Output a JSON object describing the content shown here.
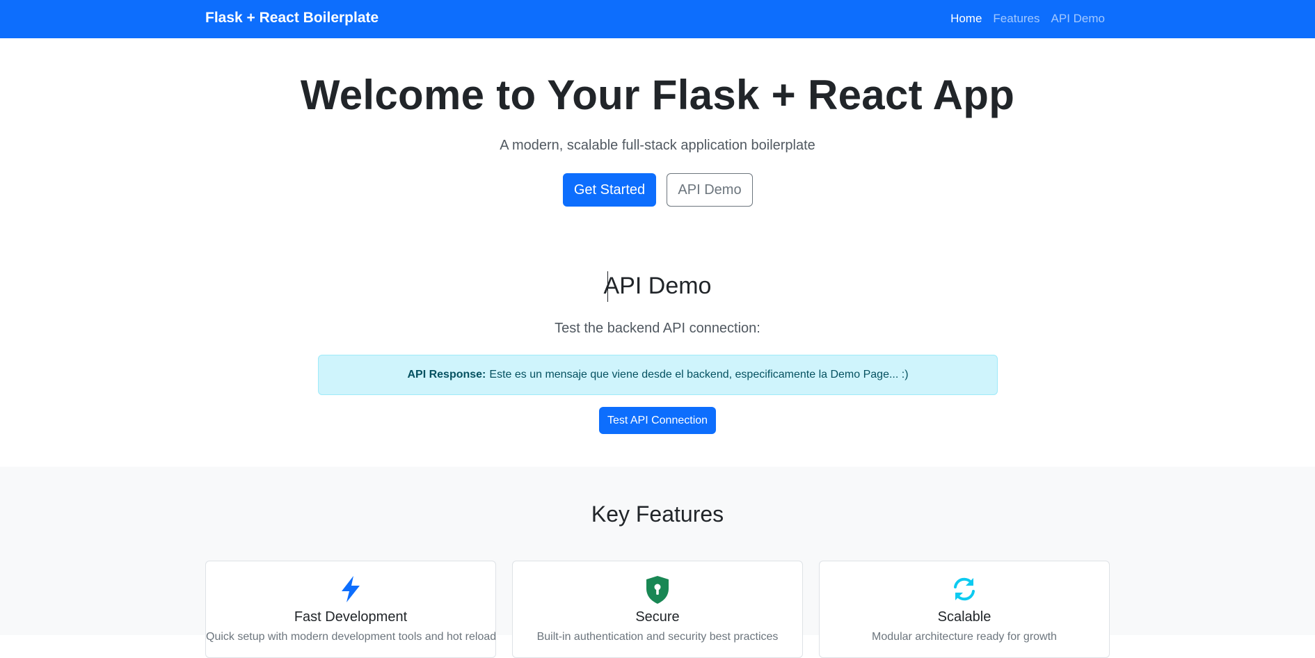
{
  "navbar": {
    "brand": "Flask + React Boilerplate",
    "links": [
      "Home",
      "Features",
      "API Demo"
    ],
    "active_link": "Home",
    "color": "#0d6efd"
  },
  "hero": {
    "title": "Welcome to Your Flask + React App",
    "subtitle": "A modern, scalable full-stack application boilerplate",
    "primary_button": "Get Started",
    "secondary_button": "API Demo"
  },
  "api_demo": {
    "title": "API Demo",
    "subtitle": "Test the backend API connection:",
    "response_label": "API Response:",
    "response_text": "Este es un mensaje que viene desde el backend, especificamente la Demo Page... :)",
    "button": "Test API Connection"
  },
  "features": {
    "title": "Key Features",
    "cards": [
      {
        "icon": "lightning-icon",
        "title": "Fast Development",
        "text": "Quick setup with modern development tools and hot reload"
      },
      {
        "icon": "shield-lock-icon",
        "title": "Secure",
        "text": "Built-in authentication and security best practices"
      },
      {
        "icon": "refresh-icon",
        "title": "Scalable",
        "text": "Modular architecture ready for growth"
      }
    ]
  }
}
